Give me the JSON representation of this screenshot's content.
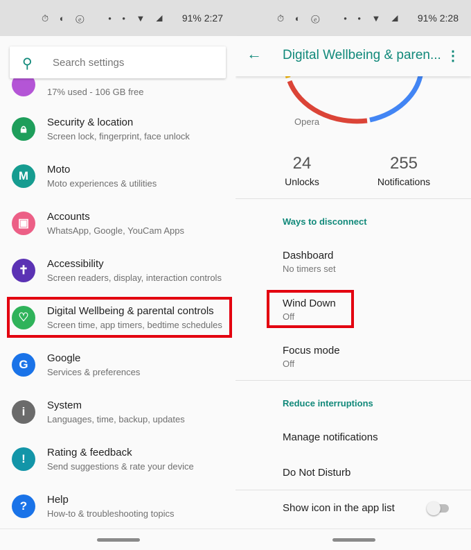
{
  "left": {
    "status": {
      "time": "2:27",
      "battery": "91%",
      "network": "4G"
    },
    "search": {
      "placeholder": "Search settings"
    },
    "partial_item": {
      "subtitle": "17% used - 106 GB free",
      "color": "#b455d6"
    },
    "items": [
      {
        "title": "Security & location",
        "subtitle": "Screen lock, fingerprint, face unlock",
        "icon": "lock-icon",
        "glyph": "🔒︎",
        "color": "#1e9e5b"
      },
      {
        "title": "Moto",
        "subtitle": "Moto experiences & utilities",
        "icon": "moto-icon",
        "glyph": "M",
        "color": "#169c90"
      },
      {
        "title": "Accounts",
        "subtitle": "WhatsApp, Google, YouCam Apps",
        "icon": "account-icon",
        "glyph": "▣",
        "color": "#ec5f86"
      },
      {
        "title": "Accessibility",
        "subtitle": "Screen readers, display, interaction controls",
        "icon": "accessibility-icon",
        "glyph": "✝",
        "color": "#5b32b4"
      },
      {
        "title": "Digital Wellbeing & parental controls",
        "subtitle": "Screen time, app timers, bedtime schedules",
        "icon": "wellbeing-icon",
        "glyph": "♡",
        "color": "#2fb35a"
      },
      {
        "title": "Google",
        "subtitle": "Services & preferences",
        "icon": "google-icon",
        "glyph": "G",
        "color": "#1a73e8"
      },
      {
        "title": "System",
        "subtitle": "Languages, time, backup, updates",
        "icon": "info-icon",
        "glyph": "i",
        "color": "#6b6b6b"
      },
      {
        "title": "Rating & feedback",
        "subtitle": "Send suggestions & rate your device",
        "icon": "feedback-icon",
        "glyph": "!",
        "color": "#1395a8"
      },
      {
        "title": "Help",
        "subtitle": "How-to & troubleshooting topics",
        "icon": "help-icon",
        "glyph": "?",
        "color": "#1a73e8"
      }
    ]
  },
  "right": {
    "status": {
      "time": "2:28",
      "battery": "91%",
      "network": "4G"
    },
    "header": {
      "title": "Digital Wellbeing & paren..."
    },
    "chart": {
      "label": "Opera",
      "colors": [
        "#f4b400",
        "#db4437",
        "#4285f4"
      ]
    },
    "stats": [
      {
        "value": "24",
        "label": "Unlocks"
      },
      {
        "value": "255",
        "label": "Notifications"
      }
    ],
    "ways_header": "Ways to disconnect",
    "dashboard": {
      "title": "Dashboard",
      "subtitle": "No timers set"
    },
    "wind_down": {
      "title": "Wind Down",
      "subtitle": "Off"
    },
    "focus": {
      "title": "Focus mode",
      "subtitle": "Off"
    },
    "reduce_header": "Reduce interruptions",
    "manage": "Manage notifications",
    "dnd": "Do Not Disturb",
    "show_icon": {
      "label": "Show icon in the app list",
      "enabled": false
    }
  },
  "accent": "#11897a",
  "highlight": "#e3000f"
}
